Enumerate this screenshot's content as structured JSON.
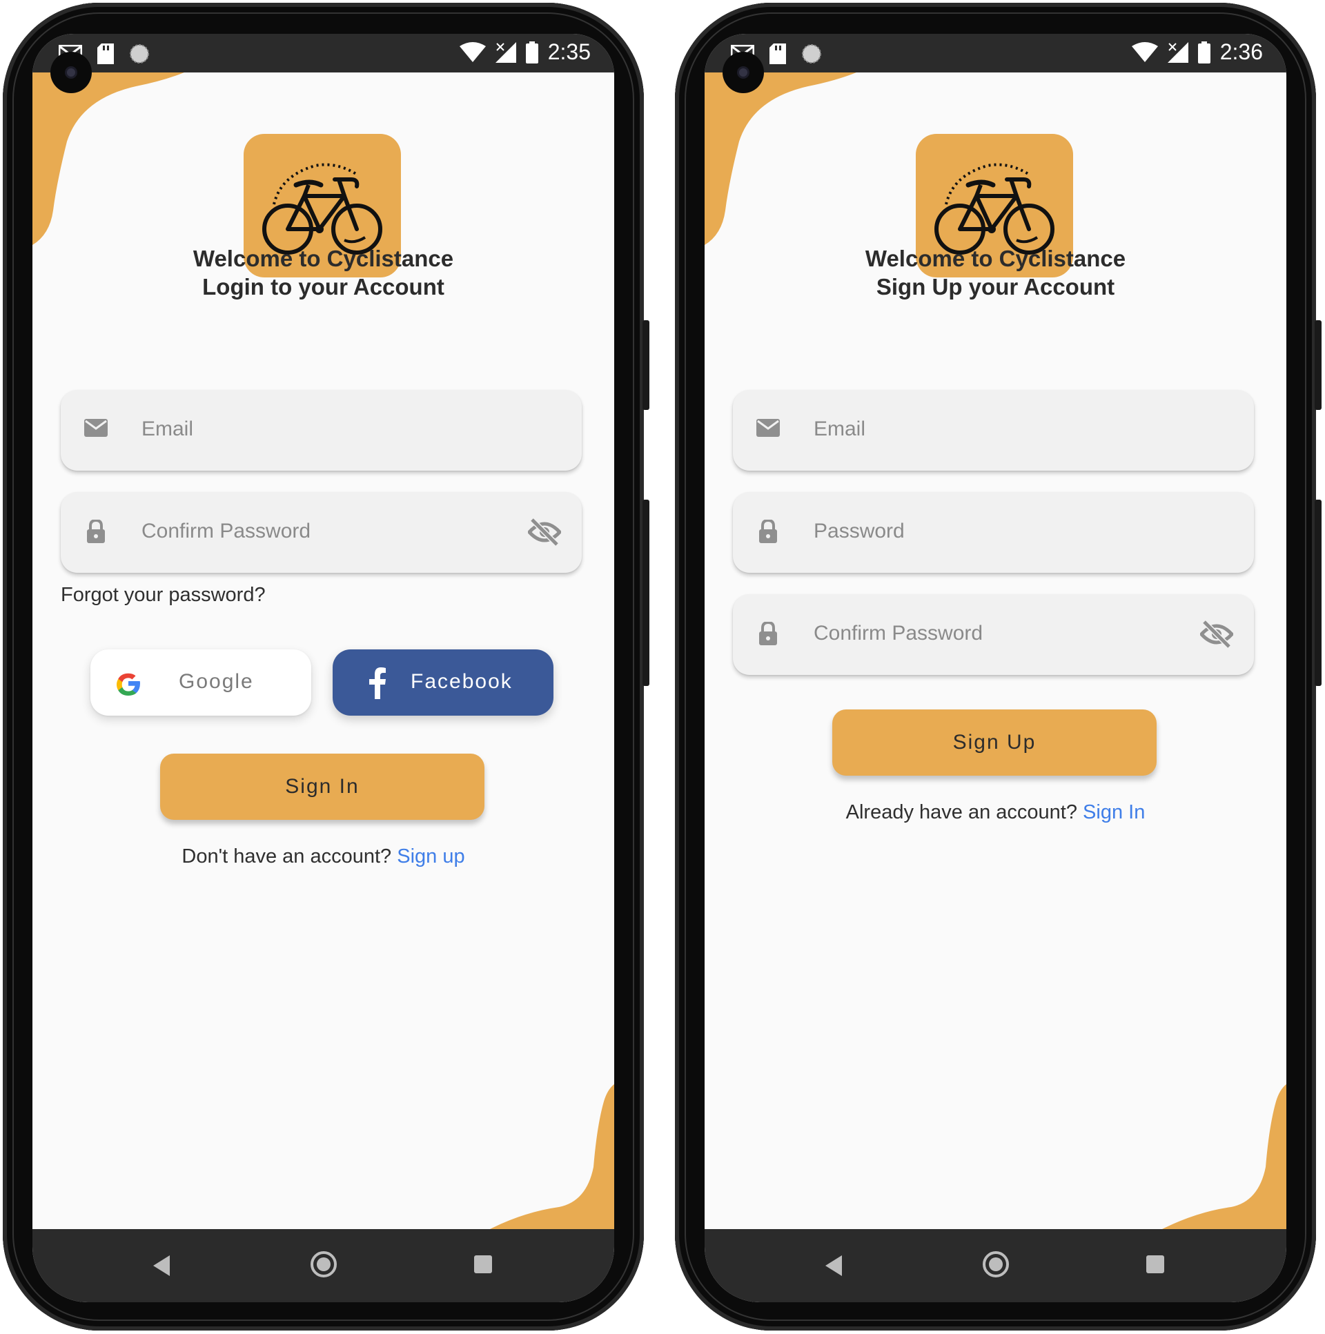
{
  "login": {
    "status": {
      "time": "2:35"
    },
    "title_line1": "Welcome to Cyclistance",
    "title_line2": "Login to your Account",
    "email_placeholder": "Email",
    "password_placeholder": "Confirm Password",
    "forgot": "Forgot your password?",
    "google_label": "Google",
    "facebook_label": "Facebook",
    "signin_label": "Sign In",
    "bottom_text": "Don't have an account?",
    "bottom_link": "Sign up"
  },
  "signup": {
    "status": {
      "time": "2:36"
    },
    "title_line1": "Welcome to Cyclistance",
    "title_line2": "Sign Up your Account",
    "email_placeholder": "Email",
    "password_placeholder": "Password",
    "confirm_placeholder": "Confirm Password",
    "signup_label": "Sign Up",
    "bottom_text": "Already have an account?",
    "bottom_link": "Sign In"
  },
  "colors": {
    "accent": "#e8ab52",
    "facebook": "#3b5998",
    "link": "#3f7ee8",
    "statusbar": "#2b2b2b"
  },
  "icons": [
    "gmail-icon",
    "sd-card-icon",
    "sync-icon",
    "wifi-icon",
    "signal-icon",
    "battery-icon",
    "bicycle-icon",
    "mail-icon",
    "lock-icon",
    "eye-off-icon",
    "google-icon",
    "facebook-icon",
    "back-icon",
    "home-icon",
    "recents-icon"
  ]
}
